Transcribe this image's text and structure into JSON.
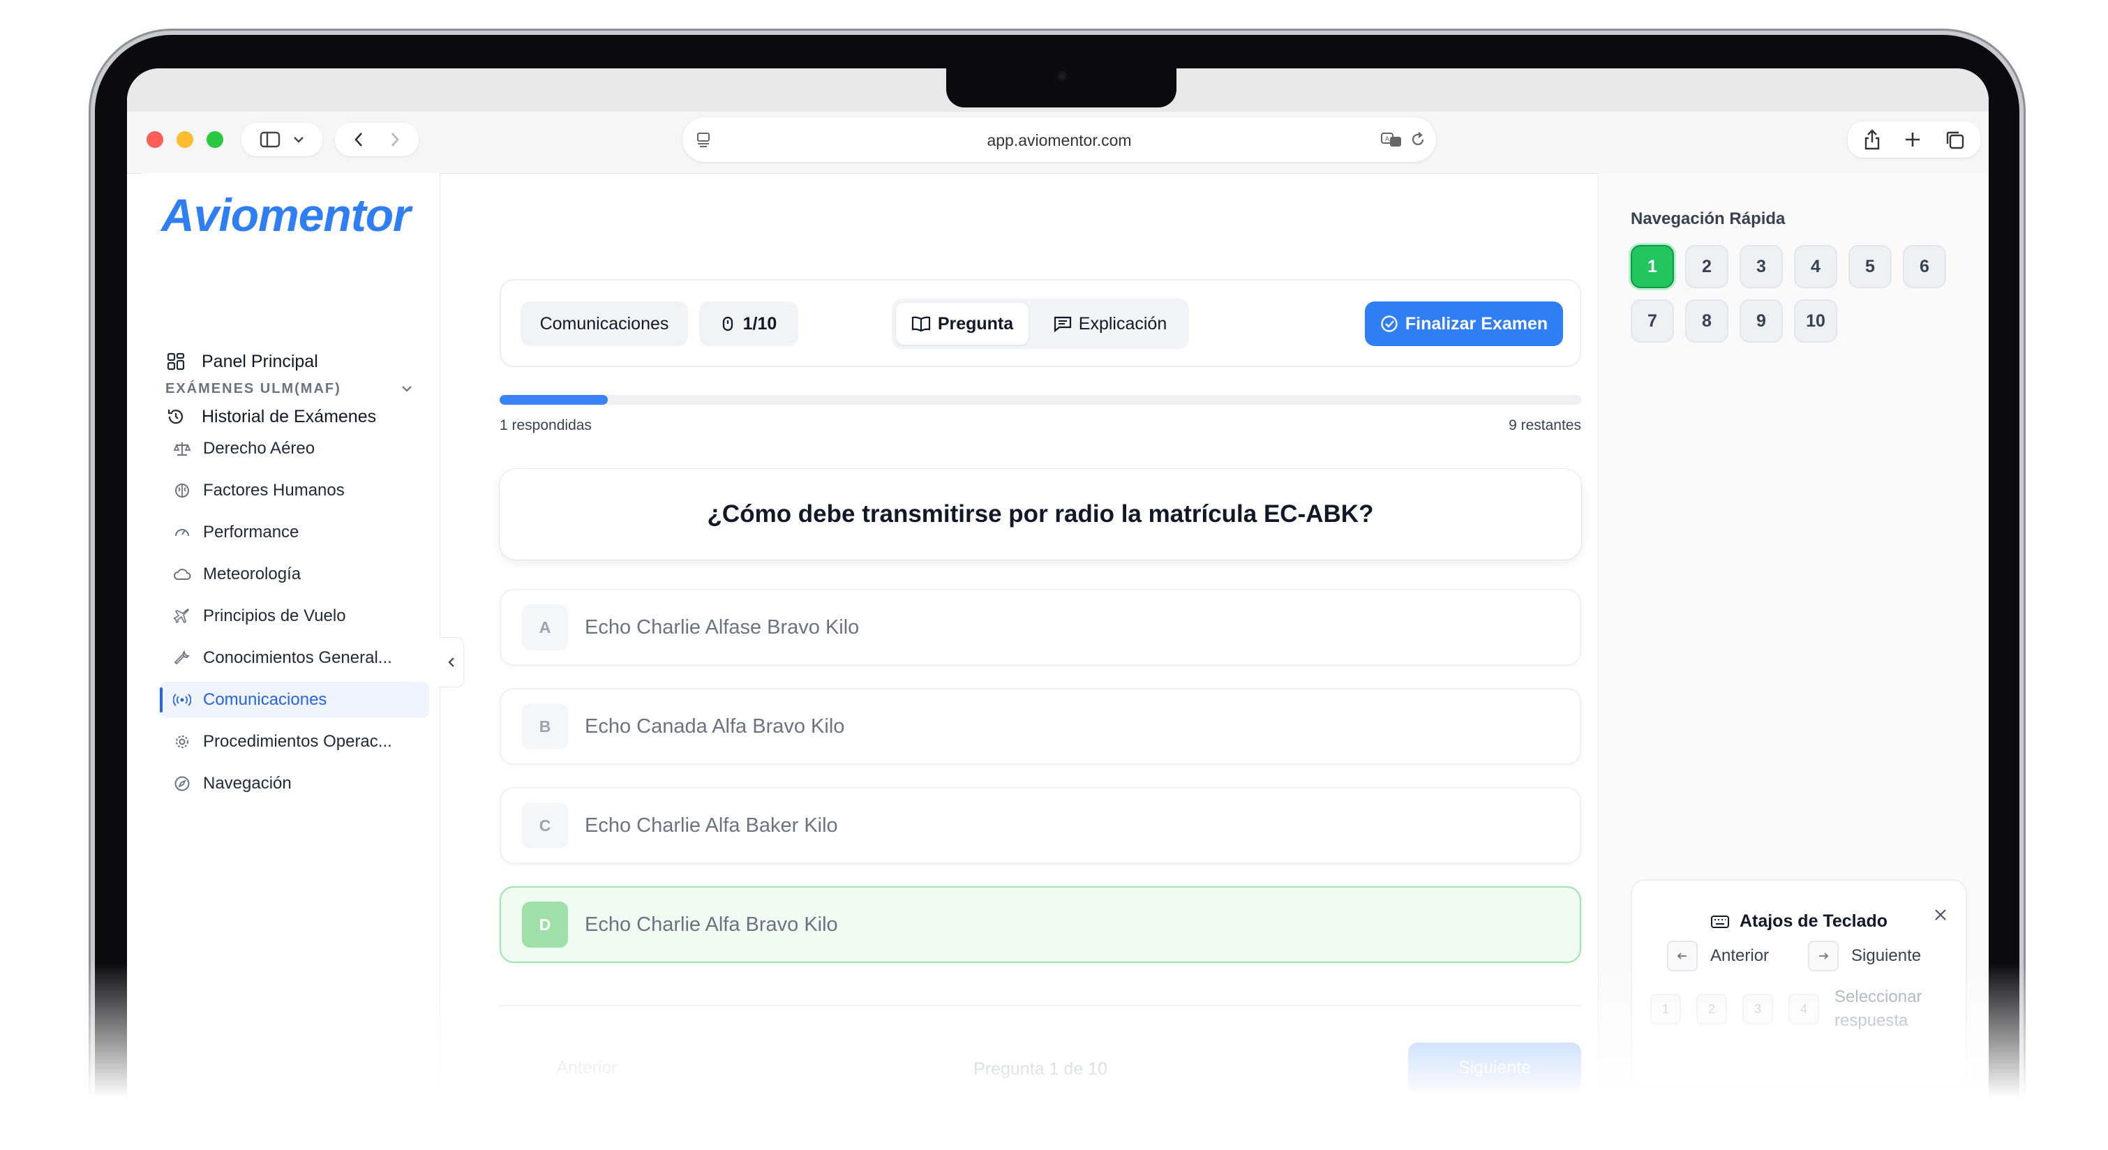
{
  "browser": {
    "url": "app.aviomentor.com",
    "traffic_lights": [
      "#ff5f57",
      "#febc2e",
      "#28c840"
    ],
    "icons": {
      "sidebar_toggle": "sidebar-toggle-icon",
      "back": "chevron-left-icon",
      "forward": "chevron-right-icon",
      "translate": "translate-icon",
      "reload": "reload-icon",
      "share": "share-icon",
      "new_tab": "plus-icon",
      "tabs": "tabs-overview-icon"
    }
  },
  "sidebar": {
    "logo": "Aviomentor",
    "main_items": [
      {
        "label": "Panel Principal",
        "icon": "dashboard-icon"
      },
      {
        "label": "Historial de Exámenes",
        "icon": "history-icon"
      }
    ],
    "section": {
      "title": "EXÁMENES ULM(MAF)",
      "icon": "chevron-down-icon"
    },
    "subjects": [
      {
        "label": "Derecho Aéreo",
        "icon": "scale-icon"
      },
      {
        "label": "Factores Humanos",
        "icon": "brain-icon"
      },
      {
        "label": "Performance",
        "icon": "gauge-icon"
      },
      {
        "label": "Meteorología",
        "icon": "cloud-icon"
      },
      {
        "label": "Principios de Vuelo",
        "icon": "plane-icon"
      },
      {
        "label": "Conocimientos General...",
        "icon": "wrench-icon"
      },
      {
        "label": "Comunicaciones",
        "icon": "radio-icon",
        "active": true
      },
      {
        "label": "Procedimientos Operac...",
        "icon": "gear-icon"
      },
      {
        "label": "Navegación",
        "icon": "compass-icon"
      }
    ]
  },
  "toolbar": {
    "subject": "Comunicaciones",
    "counter": "1/10",
    "tab_question": "Pregunta",
    "tab_explanation": "Explicación",
    "finish": "Finalizar Examen"
  },
  "progress": {
    "answered_text": "1 respondidas",
    "remaining_text": "9 restantes",
    "value": 0.1
  },
  "question": {
    "text": "¿Cómo debe transmitirse por radio la matrícula EC-ABK?",
    "options": [
      {
        "letter": "A",
        "text": "Echo Charlie Alfase Bravo Kilo",
        "selected": false
      },
      {
        "letter": "B",
        "text": "Echo Canada Alfa Bravo Kilo",
        "selected": false
      },
      {
        "letter": "C",
        "text": "Echo Charlie Alfa Baker Kilo",
        "selected": false
      },
      {
        "letter": "D",
        "text": "Echo Charlie Alfa Bravo Kilo",
        "selected": true
      }
    ]
  },
  "footer_nav": {
    "previous": "Anterior",
    "indicator": "Pregunta 1 de 10",
    "next": "Siguiente"
  },
  "quick_nav": {
    "title": "Navegación Rápida",
    "questions": [
      "1",
      "2",
      "3",
      "4",
      "5",
      "6",
      "7",
      "8",
      "9",
      "10"
    ],
    "current": "1"
  },
  "shortcuts": {
    "title": "Atajos de Teclado",
    "previous": "Anterior",
    "next": "Siguiente",
    "select": "Seleccionar respuesta",
    "keys": [
      "1",
      "2",
      "3",
      "4"
    ]
  }
}
